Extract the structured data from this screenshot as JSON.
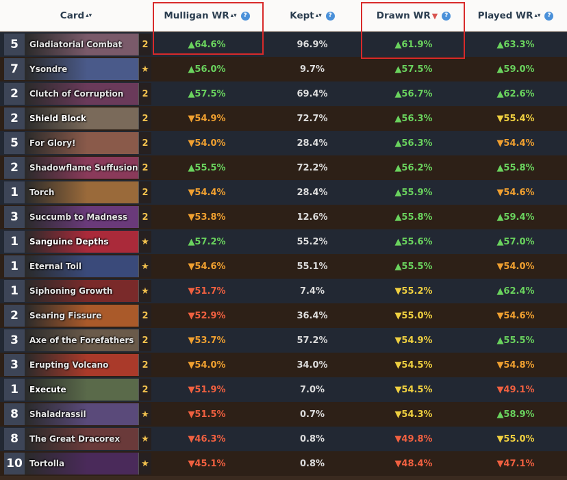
{
  "header": {
    "card": "Card",
    "mulligan": "Mulligan WR",
    "kept": "Kept",
    "drawn": "Drawn WR",
    "played": "Played WR",
    "sort_icon": "▴▾",
    "sort_active_icon": "▼",
    "help_icon": "?"
  },
  "colors": {
    "up": "#6ad35e",
    "down_yellow": "#f0d040",
    "down_orange": "#f0a030",
    "down_red": "#f06040",
    "highlight": "#d82a2a"
  },
  "rows": [
    {
      "cost": "5",
      "name": "Gladiatorial Combat",
      "count": "2",
      "mulligan": "▲64.6%",
      "kept": "96.9%",
      "drawn": "▲61.9%",
      "played": "▲63.3%",
      "mc": "up",
      "dc": "up",
      "pc": "up",
      "art": "#7a5a6a"
    },
    {
      "cost": "7",
      "name": "Ysondre",
      "count": "★",
      "mulligan": "▲56.0%",
      "kept": "9.7%",
      "drawn": "▲57.5%",
      "played": "▲59.0%",
      "mc": "up",
      "dc": "up",
      "pc": "up",
      "art": "#4a5a8a"
    },
    {
      "cost": "2",
      "name": "Clutch of Corruption",
      "count": "2",
      "mulligan": "▲57.5%",
      "kept": "69.4%",
      "drawn": "▲56.7%",
      "played": "▲62.6%",
      "mc": "up",
      "dc": "up",
      "pc": "up",
      "art": "#6a3a5a"
    },
    {
      "cost": "2",
      "name": "Shield Block",
      "count": "2",
      "mulligan": "▼54.9%",
      "kept": "72.7%",
      "drawn": "▲56.3%",
      "played": "▼55.4%",
      "mc": "dn-o",
      "dc": "up",
      "pc": "dn-y",
      "art": "#7a6a5a",
      "white": true
    },
    {
      "cost": "5",
      "name": "For Glory!",
      "count": "2",
      "mulligan": "▼54.0%",
      "kept": "28.4%",
      "drawn": "▲56.3%",
      "played": "▼54.4%",
      "mc": "dn-o",
      "dc": "up",
      "pc": "dn-o",
      "art": "#8a5a4a"
    },
    {
      "cost": "2",
      "name": "Shadowflame Suffusion",
      "count": "2",
      "mulligan": "▲55.5%",
      "kept": "72.2%",
      "drawn": "▲56.2%",
      "played": "▲55.8%",
      "mc": "up",
      "dc": "up",
      "pc": "up",
      "art": "#8a3a5a"
    },
    {
      "cost": "1",
      "name": "Torch",
      "count": "2",
      "mulligan": "▼54.4%",
      "kept": "28.4%",
      "drawn": "▲55.9%",
      "played": "▼54.6%",
      "mc": "dn-o",
      "dc": "up",
      "pc": "dn-o",
      "art": "#9a6a3a"
    },
    {
      "cost": "3",
      "name": "Succumb to Madness",
      "count": "2",
      "mulligan": "▼53.8%",
      "kept": "12.6%",
      "drawn": "▲55.8%",
      "played": "▲59.4%",
      "mc": "dn-o",
      "dc": "up",
      "pc": "up",
      "art": "#6a3a7a"
    },
    {
      "cost": "1",
      "name": "Sanguine Depths",
      "count": "★",
      "mulligan": "▲57.2%",
      "kept": "55.2%",
      "drawn": "▲55.6%",
      "played": "▲57.0%",
      "mc": "up",
      "dc": "up",
      "pc": "up",
      "art": "#aa2a3a",
      "white": true
    },
    {
      "cost": "1",
      "name": "Eternal Toil",
      "count": "★",
      "mulligan": "▼54.6%",
      "kept": "55.1%",
      "drawn": "▲55.5%",
      "played": "▼54.0%",
      "mc": "dn-o",
      "dc": "up",
      "pc": "dn-o",
      "art": "#3a4a7a"
    },
    {
      "cost": "1",
      "name": "Siphoning Growth",
      "count": "★",
      "mulligan": "▼51.7%",
      "kept": "7.4%",
      "drawn": "▼55.2%",
      "played": "▲62.4%",
      "mc": "dn-r",
      "dc": "dn-y",
      "pc": "up",
      "art": "#7a2a2a"
    },
    {
      "cost": "2",
      "name": "Searing Fissure",
      "count": "2",
      "mulligan": "▼52.9%",
      "kept": "36.4%",
      "drawn": "▼55.0%",
      "played": "▼54.6%",
      "mc": "dn-r",
      "dc": "dn-y",
      "pc": "dn-o",
      "art": "#aa5a2a"
    },
    {
      "cost": "3",
      "name": "Axe of the Forefathers",
      "count": "2",
      "mulligan": "▼53.7%",
      "kept": "57.2%",
      "drawn": "▼54.9%",
      "played": "▲55.5%",
      "mc": "dn-o",
      "dc": "dn-y",
      "pc": "up",
      "art": "#6a5a4a"
    },
    {
      "cost": "3",
      "name": "Erupting Volcano",
      "count": "2",
      "mulligan": "▼54.0%",
      "kept": "34.0%",
      "drawn": "▼54.5%",
      "played": "▼54.8%",
      "mc": "dn-o",
      "dc": "dn-y",
      "pc": "dn-o",
      "art": "#aa3a2a"
    },
    {
      "cost": "1",
      "name": "Execute",
      "count": "2",
      "mulligan": "▼51.9%",
      "kept": "7.0%",
      "drawn": "▼54.5%",
      "played": "▼49.1%",
      "mc": "dn-r",
      "dc": "dn-y",
      "pc": "dn-r",
      "art": "#5a6a4a",
      "white": true
    },
    {
      "cost": "8",
      "name": "Shaladrassil",
      "count": "★",
      "mulligan": "▼51.5%",
      "kept": "0.7%",
      "drawn": "▼54.3%",
      "played": "▲58.9%",
      "mc": "dn-r",
      "dc": "dn-y",
      "pc": "up",
      "art": "#5a4a7a"
    },
    {
      "cost": "8",
      "name": "The Great Dracorex",
      "count": "★",
      "mulligan": "▼46.3%",
      "kept": "0.8%",
      "drawn": "▼49.8%",
      "played": "▼55.0%",
      "mc": "dn-r",
      "dc": "dn-r",
      "pc": "dn-y",
      "art": "#6a3a3a"
    },
    {
      "cost": "10",
      "name": "Tortolla",
      "count": "★",
      "mulligan": "▼45.1%",
      "kept": "0.8%",
      "drawn": "▼48.4%",
      "played": "▼47.1%",
      "mc": "dn-r",
      "dc": "dn-r",
      "pc": "dn-r",
      "art": "#4a2a5a"
    }
  ]
}
